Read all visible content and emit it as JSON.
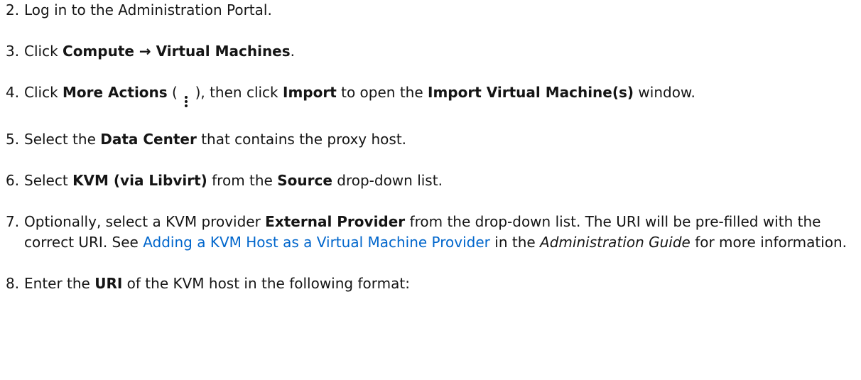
{
  "steps": [
    {
      "number": "2.",
      "segments": [
        {
          "text": "Log in to the Administration Portal."
        }
      ]
    },
    {
      "number": "3.",
      "segments": [
        {
          "text": "Click "
        },
        {
          "text": "Compute → Virtual Machines",
          "bold": true
        },
        {
          "text": "."
        }
      ]
    },
    {
      "number": "4.",
      "segments": [
        {
          "text": "Click "
        },
        {
          "text": "More Actions",
          "bold": true
        },
        {
          "text": " ( "
        },
        {
          "icon": "kebab-icon"
        },
        {
          "text": " ), then click "
        },
        {
          "text": "Import",
          "bold": true
        },
        {
          "text": " to open the "
        },
        {
          "text": "Import Virtual Machine(s)",
          "bold": true
        },
        {
          "text": " window."
        }
      ]
    },
    {
      "number": "5.",
      "segments": [
        {
          "text": "Select the "
        },
        {
          "text": "Data Center",
          "bold": true
        },
        {
          "text": " that contains the proxy host."
        }
      ]
    },
    {
      "number": "6.",
      "segments": [
        {
          "text": "Select "
        },
        {
          "text": "KVM (via Libvirt)",
          "bold": true
        },
        {
          "text": " from the "
        },
        {
          "text": "Source",
          "bold": true
        },
        {
          "text": " drop-down list."
        }
      ]
    },
    {
      "number": "7.",
      "segments": [
        {
          "text": "Optionally, select a KVM provider "
        },
        {
          "text": "External Provider",
          "bold": true
        },
        {
          "text": " from the drop-down list. The URI will be pre-filled with the correct URI. See "
        },
        {
          "text": "Adding a KVM Host as a Virtual Machine Provider",
          "link": true
        },
        {
          "text": " in the "
        },
        {
          "text": "Administration Guide",
          "italic": true
        },
        {
          "text": " for more information."
        }
      ]
    },
    {
      "number": "8.",
      "segments": [
        {
          "text": "Enter the "
        },
        {
          "text": "URI",
          "bold": true
        },
        {
          "text": " of the KVM host in the following format:"
        }
      ]
    }
  ]
}
